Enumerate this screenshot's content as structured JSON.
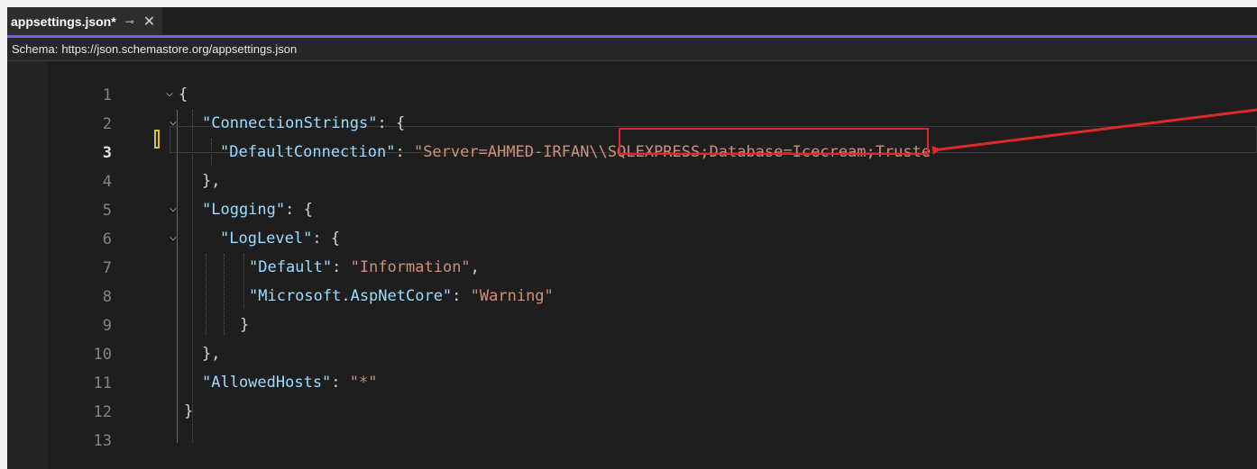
{
  "tab": {
    "title": "appsettings.json*",
    "pin_icon": "pin-icon",
    "close_icon": "close-icon"
  },
  "schema": {
    "label": "Schema:",
    "url": "https://json.schemastore.org/appsettings.json"
  },
  "editor": {
    "current_line": 3,
    "lines": [
      {
        "n": "1",
        "text": "{"
      },
      {
        "n": "2",
        "key": "\"ConnectionStrings\"",
        "rest": ": {"
      },
      {
        "n": "3",
        "key": "\"DefaultConnection\"",
        "sep": ": ",
        "value_pre": "\"Server=",
        "value_hl": "AHMED-IRFAN\\\\SQLEXPRESS",
        "value_post": ";Database=Icecream;Truste"
      },
      {
        "n": "4",
        "text": "},"
      },
      {
        "n": "5",
        "key": "\"Logging\"",
        "rest": ": {"
      },
      {
        "n": "6",
        "key": "\"LogLevel\"",
        "rest": ": {"
      },
      {
        "n": "7",
        "key": "\"Default\"",
        "sep": ": ",
        "value": "\"Information\"",
        "tail": ","
      },
      {
        "n": "8",
        "key": "\"Microsoft.AspNetCore\"",
        "sep": ": ",
        "value": "\"Warning\""
      },
      {
        "n": "9",
        "text": "}"
      },
      {
        "n": "10",
        "text": "},"
      },
      {
        "n": "11",
        "key": "\"AllowedHosts\"",
        "sep": ": ",
        "value": "\"*\""
      },
      {
        "n": "12",
        "text": "}"
      },
      {
        "n": "13",
        "text": ""
      }
    ]
  },
  "annotation": {
    "color": "#e0282b"
  },
  "colors": {
    "key": "#9cdcfe",
    "string": "#ce9178",
    "accent": "#7160e8"
  }
}
